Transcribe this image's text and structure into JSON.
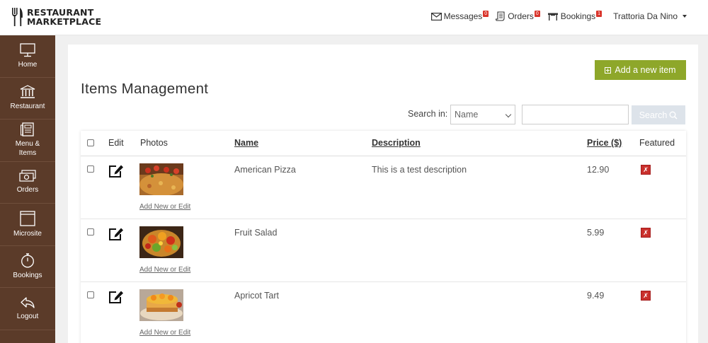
{
  "app": {
    "brand_line1": "RESTAURANT",
    "brand_line2": "MARKETPLACE"
  },
  "topnav": {
    "messages": {
      "label": "Messages",
      "count": "0"
    },
    "orders": {
      "label": "Orders",
      "count": "0"
    },
    "bookings": {
      "label": "Bookings",
      "count": "1"
    },
    "user": "Trattoria Da Nino"
  },
  "sidebar": {
    "items": [
      {
        "label": "Home",
        "icon": "monitor-icon"
      },
      {
        "label": "Restaurant",
        "icon": "building-icon"
      },
      {
        "label": "Menu &",
        "label2": "Items",
        "icon": "menu-book-icon"
      },
      {
        "label": "Orders",
        "icon": "money-icon"
      },
      {
        "label": "Microsite",
        "icon": "window-icon"
      },
      {
        "label": "Bookings",
        "icon": "stopwatch-icon"
      },
      {
        "label": "Logout",
        "icon": "reply-icon"
      }
    ]
  },
  "main": {
    "title": "Items Management",
    "add_button": "Add a new item",
    "search_label": "Search in:",
    "search_field_value": "Name",
    "search_input_value": "",
    "search_button": "Search"
  },
  "table": {
    "headers": {
      "edit": "Edit",
      "photos": "Photos",
      "name": "Name",
      "description": "Description",
      "price": "Price ($)",
      "featured": "Featured"
    },
    "photo_link_label": "Add New or Edit",
    "rows": [
      {
        "name": "American Pizza",
        "description": "This is a test description",
        "price": "12.90",
        "featured": "✗"
      },
      {
        "name": "Fruit Salad",
        "description": "",
        "price": "5.99",
        "featured": "✗"
      },
      {
        "name": "Apricot Tart",
        "description": "",
        "price": "9.49",
        "featured": "✗"
      }
    ]
  },
  "colors": {
    "sidebar_bg": "#5b3b29",
    "accent_green": "#8ea72a",
    "badge_red": "#d9342b",
    "featured_red": "#c9302c"
  }
}
